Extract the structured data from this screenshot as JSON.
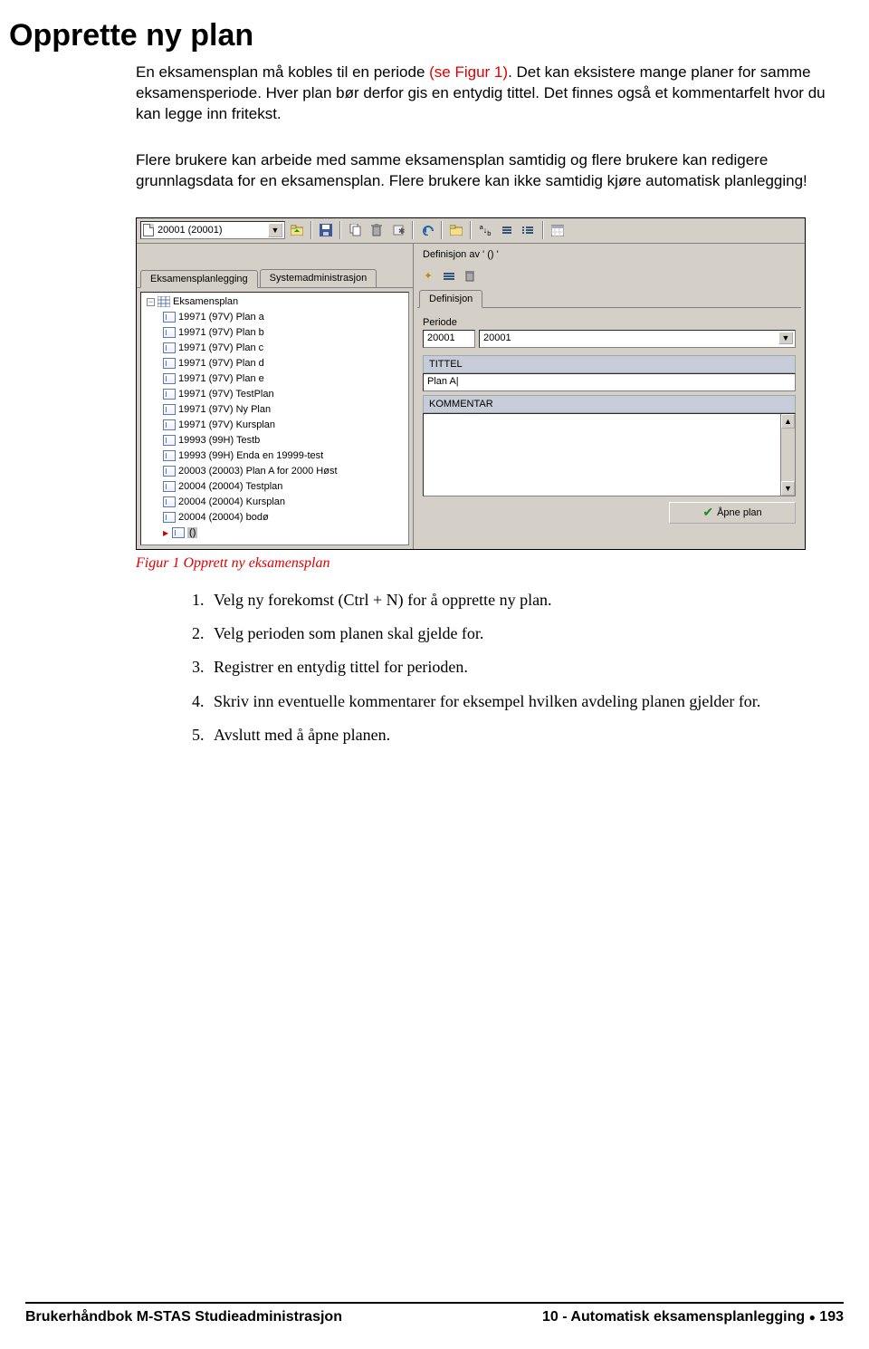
{
  "title": "Opprette ny plan",
  "intro": {
    "p1_a": "En eksamensplan må kobles til en periode ",
    "p1_ref": "(se Figur 1)",
    "p1_b": ". Det kan eksistere mange planer for samme eksamensperiode. Hver plan bør derfor gis en entydig tittel. Det finnes også et kommentarfelt hvor du kan legge inn fritekst.",
    "p2": "Flere brukere kan arbeide med samme eksamensplan samtidig og flere brukere kan redigere grunnlagsdata for en eksamensplan. Flere brukere kan ikke samtidig kjøre automatisk planlegging!"
  },
  "app": {
    "combo": "20001 (20001)",
    "def_title": "Definisjon av ' () '",
    "tabs": {
      "left1": "Eksamensplanlegging",
      "left2": "Systemadministrasjon",
      "right1": "Definisjon"
    },
    "tree_root": "Eksamensplan",
    "tree": [
      "19971 (97V) Plan a",
      "19971 (97V) Plan b",
      "19971 (97V) Plan c",
      "19971 (97V) Plan d",
      "19971 (97V) Plan e",
      "19971 (97V) TestPlan",
      "19971 (97V) Ny Plan",
      "19971 (97V) Kursplan",
      "19993 (99H) Testb",
      "19993 (99H) Enda en 19999-test",
      "20003 (20003) Plan A for 2000 Høst",
      "20004 (20004) Testplan",
      "20004 (20004) Kursplan",
      "20004 (20004) bodø"
    ],
    "tree_last": "()",
    "labels": {
      "periode": "Periode",
      "tittel": "TITTEL",
      "kommentar": "KOMMENTAR"
    },
    "fields": {
      "periode_code": "20001",
      "periode_name": "20001",
      "tittel": "Plan A|"
    },
    "open_btn": "Åpne plan"
  },
  "caption": "Figur 1 Opprett ny eksamensplan",
  "steps": [
    "Velg ny forekomst (Ctrl + N) for å opprette ny plan.",
    "Velg perioden som planen skal gjelde for.",
    "Registrer en entydig tittel for perioden.",
    "Skriv inn eventuelle kommentarer for eksempel hvilken avdeling planen gjelder for.",
    "Avslutt med å åpne planen."
  ],
  "footer": {
    "left": "Brukerhåndbok M-STAS Studieadministrasjon",
    "right": "10 - Automatisk eksamensplanlegging",
    "page": "193"
  }
}
